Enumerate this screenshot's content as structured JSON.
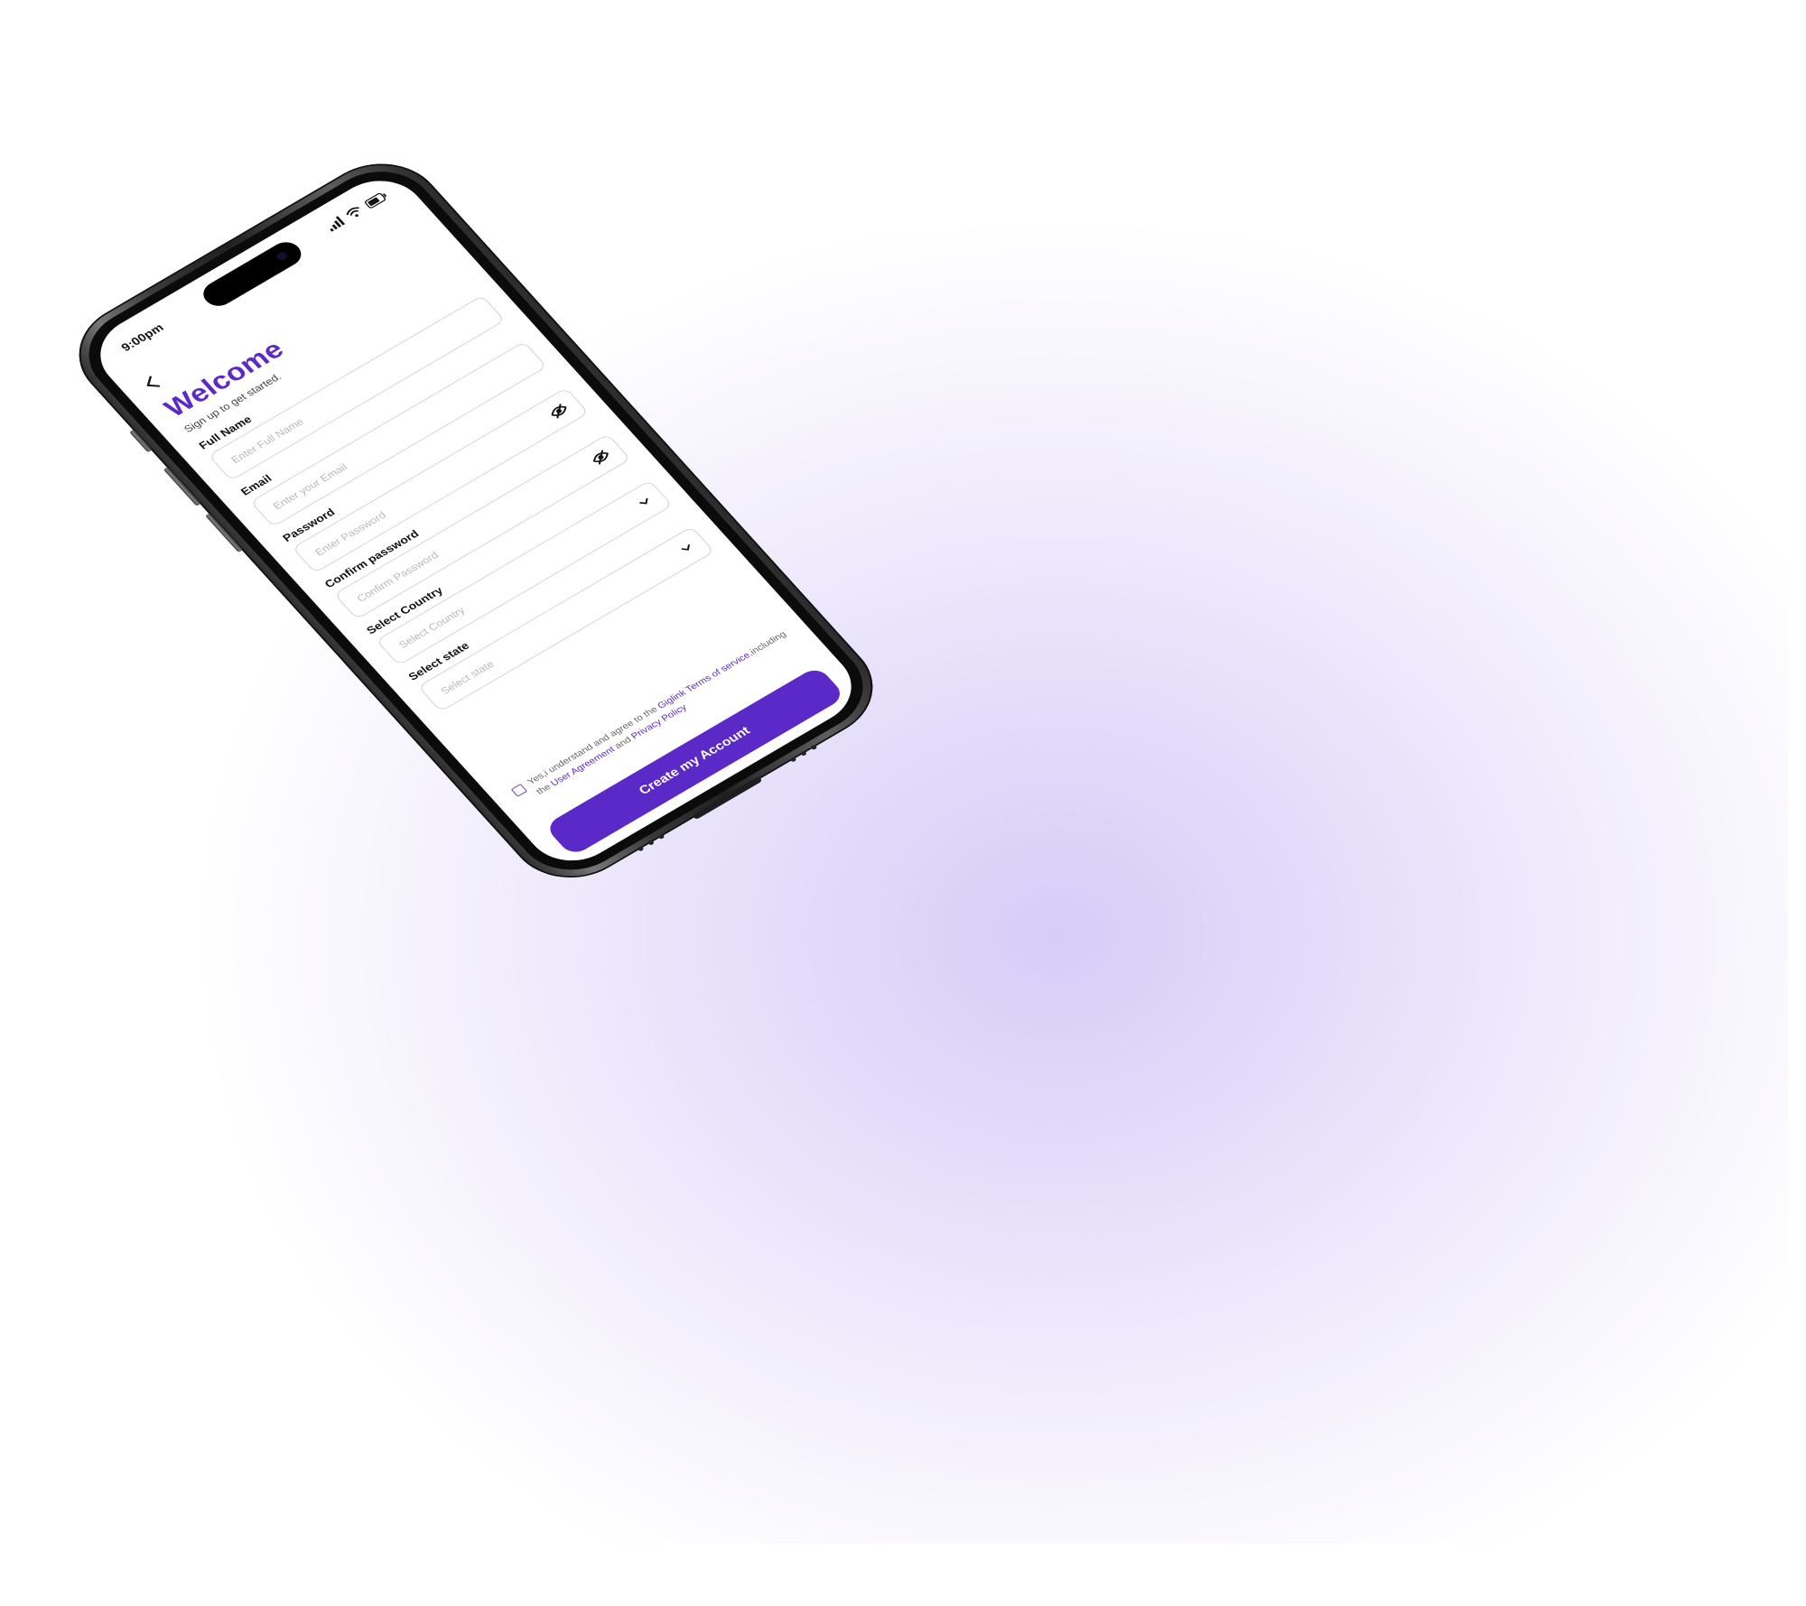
{
  "status_bar": {
    "time": "9:00pm",
    "signal_icon": "signal-icon",
    "wifi_icon": "wifi-icon",
    "battery_icon": "battery-icon"
  },
  "nav": {
    "back_icon": "chevron-left-icon"
  },
  "header": {
    "title": "Welcome",
    "subtitle": "Sign up to get started."
  },
  "form": {
    "fields": [
      {
        "label": "Full Name",
        "placeholder": "Enter Full Name",
        "trailing_icon": ""
      },
      {
        "label": "Email",
        "placeholder": "Enter your Email",
        "trailing_icon": ""
      },
      {
        "label": "Password",
        "placeholder": "Enter Password",
        "trailing_icon": "eye-off-icon"
      },
      {
        "label": "Confirm password",
        "placeholder": "Confirm Password",
        "trailing_icon": "eye-off-icon"
      },
      {
        "label": "Select Country",
        "placeholder": "Select Country",
        "trailing_icon": "chevron-down-icon"
      },
      {
        "label": "Select state",
        "placeholder": "Select state",
        "trailing_icon": "chevron-down-icon"
      }
    ]
  },
  "terms": {
    "checked": false,
    "prefix": "Yes,i understand and agree to the ",
    "link1": "Giglink Terms of service",
    "middle": ",including the ",
    "link2": "User Agreement",
    "and": " and ",
    "link3": "Privacy Policy"
  },
  "cta": {
    "label": "Create my Account"
  },
  "colors": {
    "accent": "#5b29c8",
    "border": "#cfcfcf",
    "placeholder": "#b9b9b9"
  }
}
